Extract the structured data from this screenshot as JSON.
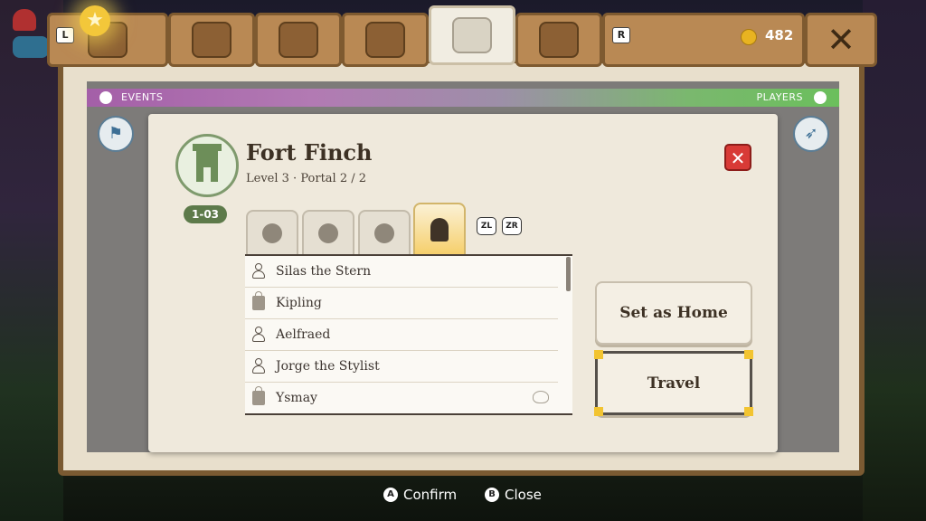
{
  "topbar": {
    "left_key": "L",
    "right_key": "R",
    "coins": "482",
    "tabs": [
      "skills-icon",
      "helmet-icon",
      "chest-icon",
      "build-icon",
      "map-icon",
      "scroll-icon"
    ]
  },
  "banner": {
    "events_label": "EVENTS",
    "players_label": "PLAYERS"
  },
  "dialog": {
    "title": "Fort Finch",
    "subtitle": "Level 3 · Portal 2 / 2",
    "level_badge": "1-03",
    "close_symbol": "✕",
    "filter_keys": [
      "ZL",
      "ZR"
    ],
    "list": [
      {
        "icon": "person-icon",
        "name": "Silas the Stern",
        "extra": false
      },
      {
        "icon": "shop-icon",
        "name": "Kipling",
        "extra": false
      },
      {
        "icon": "person-icon",
        "name": "Aelfraed",
        "extra": false
      },
      {
        "icon": "person-icon",
        "name": "Jorge the Stylist",
        "extra": false
      },
      {
        "icon": "shop-icon",
        "name": "Ysmay",
        "extra": true
      }
    ],
    "set_home_label": "Set as Home",
    "travel_label": "Travel"
  },
  "footer": {
    "confirm_key": "A",
    "confirm_label": "Confirm",
    "close_key": "B",
    "close_label": "Close"
  },
  "colors": {
    "accent_gold": "#f2c431",
    "wood": "#b98954",
    "parchment": "#efe9dc",
    "close_red": "#d83a36",
    "banner_purple": "#a45fa8",
    "banner_green": "#6bbf5c"
  }
}
